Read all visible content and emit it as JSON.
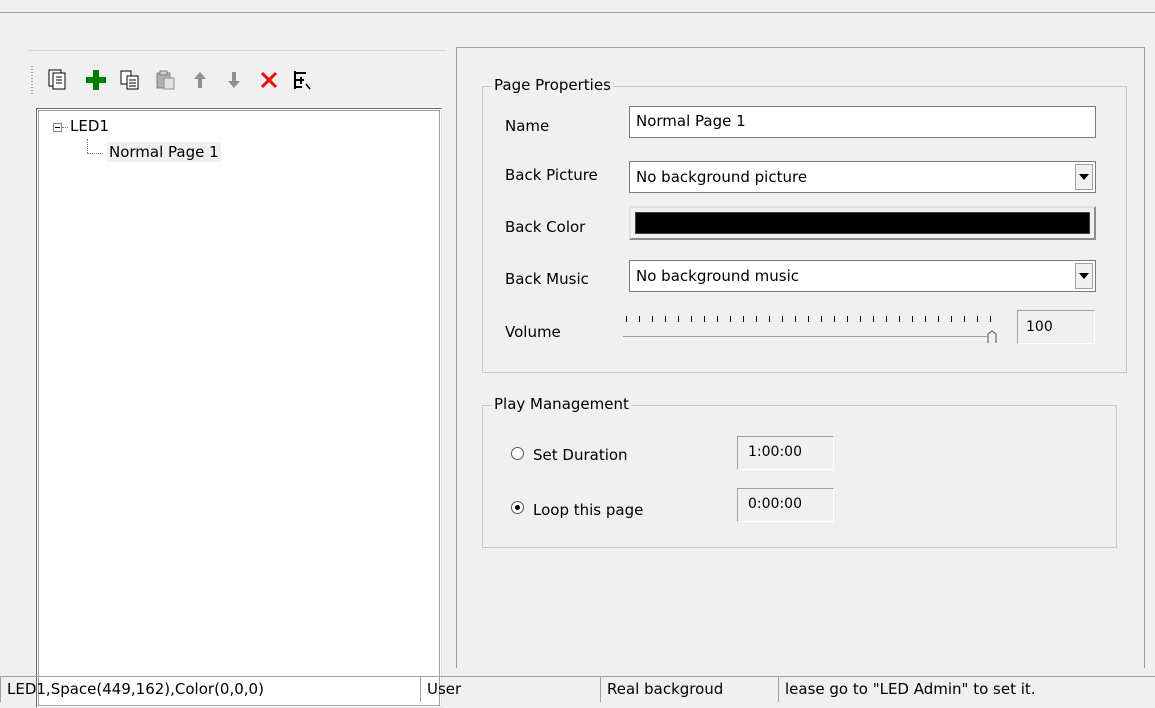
{
  "toolbar": {
    "icons": [
      "new-page-icon",
      "add-icon",
      "copy-icon",
      "paste-icon",
      "move-up-icon",
      "move-down-icon",
      "delete-icon",
      "tree-icon"
    ],
    "colors": {
      "add": "#008000",
      "delete": "#ff0000",
      "arrow": "#808080"
    }
  },
  "tree": {
    "root": "LED1",
    "child": "Normal Page 1"
  },
  "page_properties": {
    "title": "Page Properties",
    "name_label": "Name",
    "name_value": "Normal Page 1",
    "back_picture_label": "Back Picture",
    "back_picture_value": "No background picture",
    "back_color_label": "Back Color",
    "back_color_value": "#000000",
    "back_music_label": "Back Music",
    "back_music_value": "No background music",
    "volume_label": "Volume",
    "volume_value": "100"
  },
  "play_management": {
    "title": "Play Management",
    "set_duration_label": "Set Duration",
    "set_duration_value": "1:00:00",
    "loop_label": "Loop this page",
    "loop_value": "0:00:00",
    "selected": "loop"
  },
  "status_bar": {
    "info": "LED1,Space(449,162),Color(0,0,0)",
    "user": "User",
    "background": "Real backgroud",
    "message": "lease go to \"LED Admin\" to set it."
  }
}
